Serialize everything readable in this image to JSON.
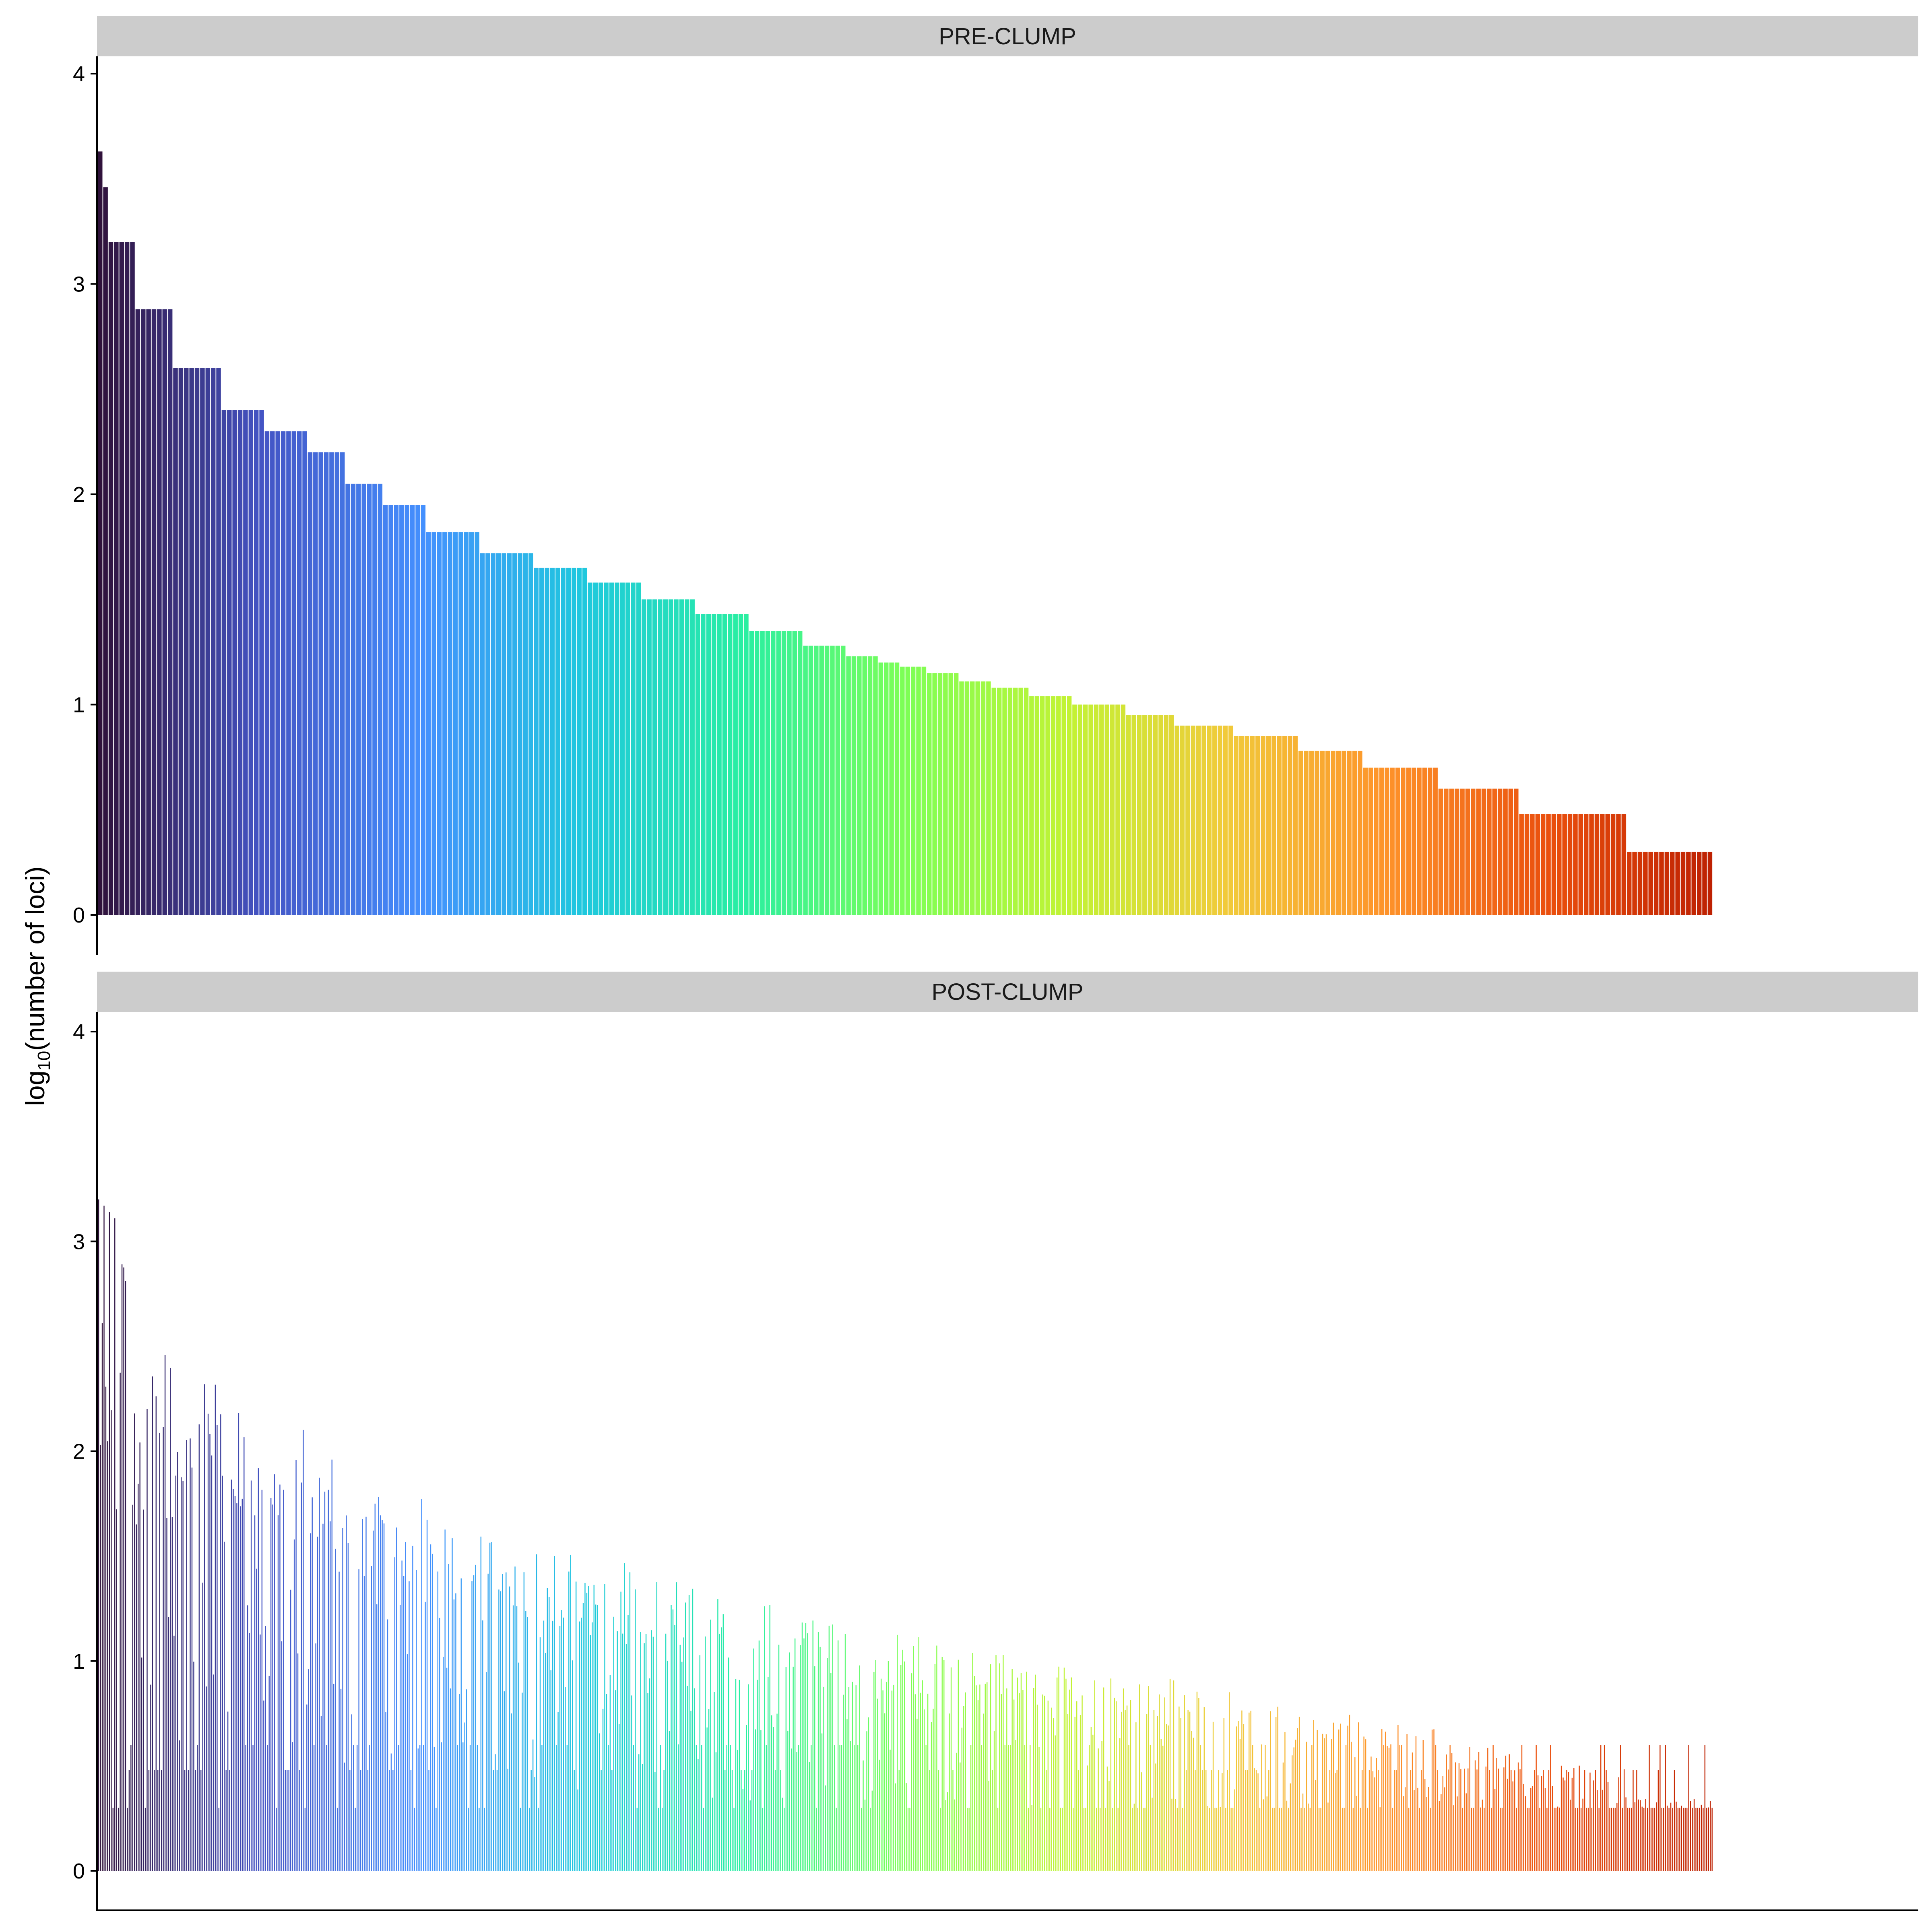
{
  "colors": {
    "background": "#ffffff",
    "strip_fill": "#cccccc",
    "axis": "#000000",
    "gradient": [
      "#30123b",
      "#4454c4",
      "#4490fe",
      "#1fc8de",
      "#29efa2",
      "#7dff56",
      "#c1f334",
      "#f1ca3a",
      "#fe922a",
      "#ea4f0d",
      "#be2102"
    ]
  },
  "chart_data": {
    "type": "bar",
    "ylabel": "log10(number of loci)",
    "ylabel_parts": {
      "prefix": "log",
      "subscript": "10",
      "open": "(",
      "inner": "number of loci",
      "close": ")"
    },
    "ylim": [
      0,
      4.1
    ],
    "yticks": [
      0,
      1,
      2,
      3,
      4
    ],
    "ytick_labels": [
      "0",
      "1",
      "2",
      "3",
      "4"
    ],
    "grid": false,
    "legend": "none",
    "fill": "rainbow gradient by bar rank, dark purple to dark red",
    "panels": [
      {
        "name": "PRE-CLUMP",
        "n_bars": 300,
        "description": "bars sorted in decreasing order of value",
        "levels": [
          {
            "value": 3.63,
            "from": 0,
            "to": 0
          },
          {
            "value": 3.46,
            "from": 1,
            "to": 1
          },
          {
            "value": 3.2,
            "from": 2,
            "to": 6
          },
          {
            "value": 2.88,
            "from": 7,
            "to": 13
          },
          {
            "value": 2.6,
            "from": 14,
            "to": 22
          },
          {
            "value": 2.4,
            "from": 23,
            "to": 30
          },
          {
            "value": 2.3,
            "from": 31,
            "to": 38
          },
          {
            "value": 2.2,
            "from": 39,
            "to": 45
          },
          {
            "value": 2.05,
            "from": 46,
            "to": 52
          },
          {
            "value": 1.95,
            "from": 53,
            "to": 60
          },
          {
            "value": 1.82,
            "from": 61,
            "to": 70
          },
          {
            "value": 1.72,
            "from": 71,
            "to": 80
          },
          {
            "value": 1.65,
            "from": 81,
            "to": 90
          },
          {
            "value": 1.58,
            "from": 91,
            "to": 100
          },
          {
            "value": 1.5,
            "from": 101,
            "to": 110
          },
          {
            "value": 1.43,
            "from": 111,
            "to": 120
          },
          {
            "value": 1.35,
            "from": 121,
            "to": 130
          },
          {
            "value": 1.28,
            "from": 131,
            "to": 138
          },
          {
            "value": 1.23,
            "from": 139,
            "to": 144
          },
          {
            "value": 1.2,
            "from": 145,
            "to": 148
          },
          {
            "value": 1.18,
            "from": 149,
            "to": 153
          },
          {
            "value": 1.15,
            "from": 154,
            "to": 159
          },
          {
            "value": 1.11,
            "from": 160,
            "to": 165
          },
          {
            "value": 1.08,
            "from": 166,
            "to": 172
          },
          {
            "value": 1.04,
            "from": 173,
            "to": 180
          },
          {
            "value": 1.0,
            "from": 181,
            "to": 190
          },
          {
            "value": 0.95,
            "from": 191,
            "to": 199
          },
          {
            "value": 0.9,
            "from": 200,
            "to": 210
          },
          {
            "value": 0.85,
            "from": 211,
            "to": 222
          },
          {
            "value": 0.78,
            "from": 223,
            "to": 234
          },
          {
            "value": 0.7,
            "from": 235,
            "to": 248
          },
          {
            "value": 0.6,
            "from": 249,
            "to": 263
          },
          {
            "value": 0.48,
            "from": 264,
            "to": 283
          },
          {
            "value": 0.3,
            "from": 284,
            "to": 299
          }
        ]
      },
      {
        "name": "POST-CLUMP",
        "n_bars": 300,
        "description": "same ordering as PRE-CLUMP; thin bars, reduced and scattered values",
        "max_value": 3.2,
        "envelope_end_value": 0.3,
        "low_levels": [
          0.3,
          0.48,
          0.6
        ]
      }
    ]
  }
}
